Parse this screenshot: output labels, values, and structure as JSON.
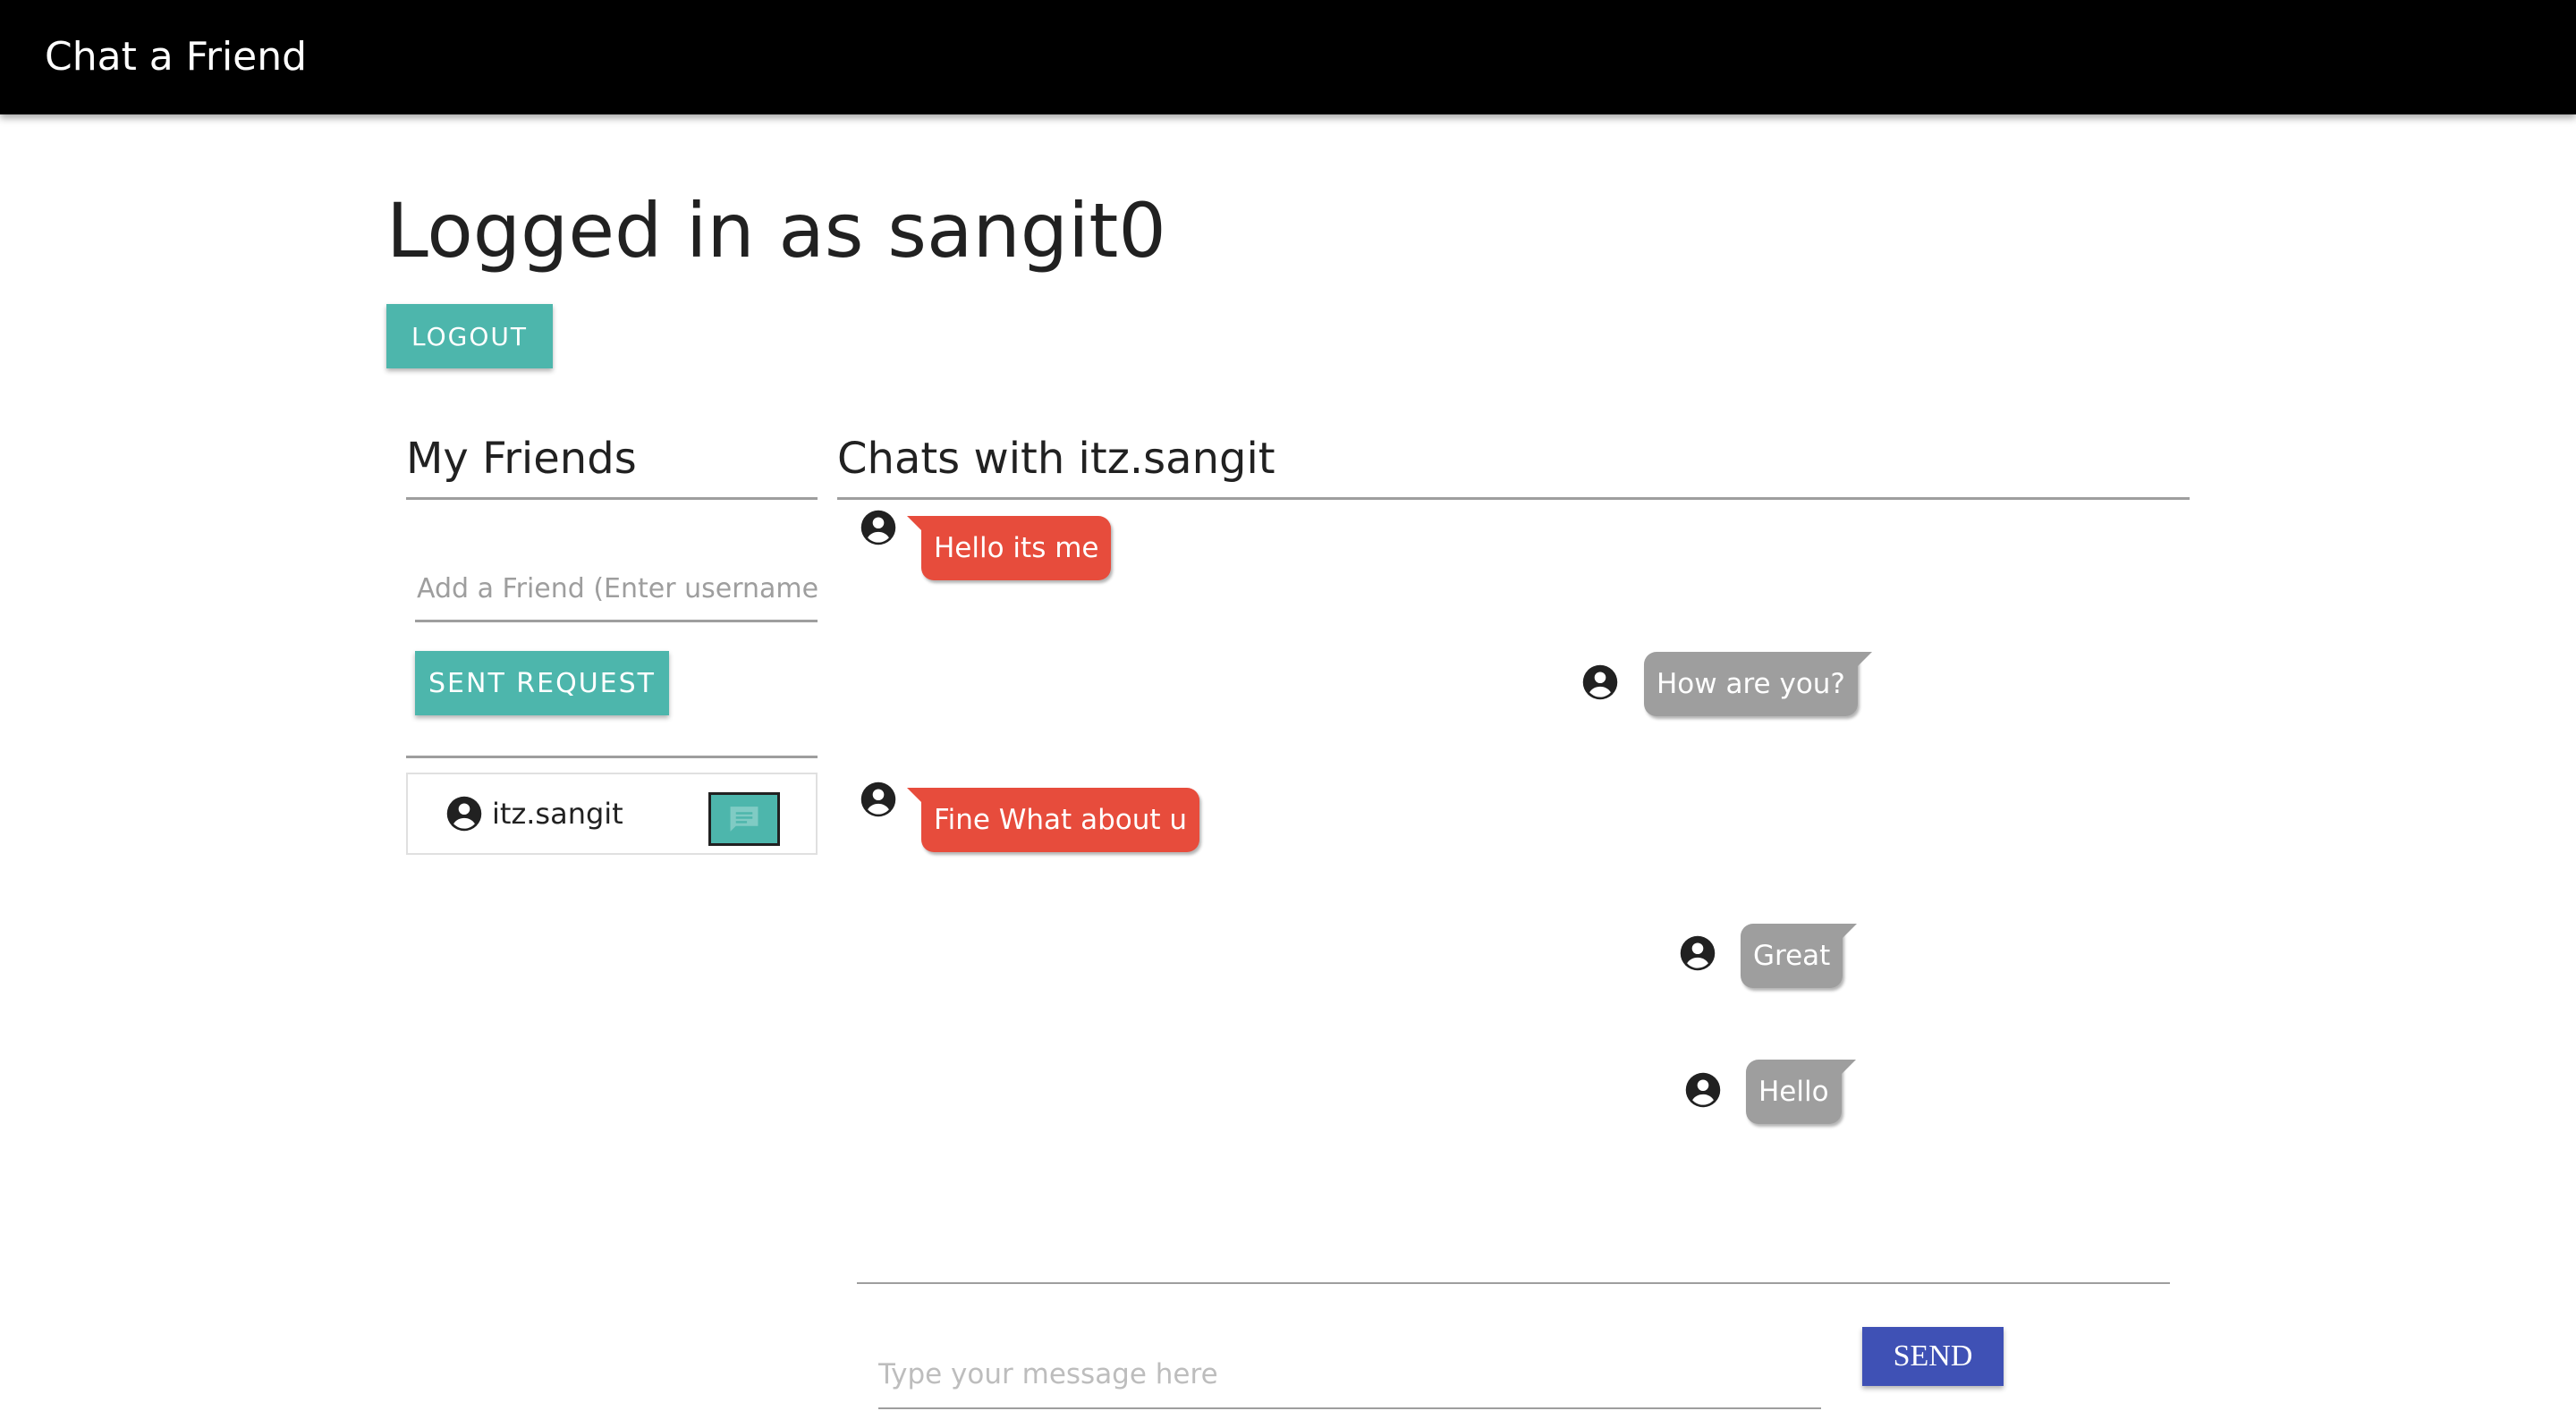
{
  "app": {
    "title": "Chat a Friend"
  },
  "page": {
    "title": "Logged in as sangit0",
    "logout_label": "LOGOUT"
  },
  "friends": {
    "title": "My Friends",
    "add_placeholder": "Add a Friend (Enter username)",
    "sent_label": "SENT REQUEST",
    "list": [
      {
        "name": "itz.sangit"
      }
    ]
  },
  "chat": {
    "title": "Chats with itz.sangit",
    "messages": [
      {
        "text": "Hello its me",
        "side": "left"
      },
      {
        "text": "How are you?",
        "side": "right"
      },
      {
        "text": "Fine What about u",
        "side": "left"
      },
      {
        "text": "Great",
        "side": "right"
      },
      {
        "text": "Hello",
        "side": "right"
      }
    ],
    "input_placeholder": "Type your message here",
    "send_label": "SEND"
  },
  "colors": {
    "appbar": "#000000",
    "primary_teal": "#4db6ac",
    "send_indigo": "#3f51b5",
    "bubble_sent": "#e74c3c",
    "bubble_received": "#9e9e9e"
  },
  "icons": {
    "avatar": "account-circle-icon",
    "chat": "message-icon"
  }
}
